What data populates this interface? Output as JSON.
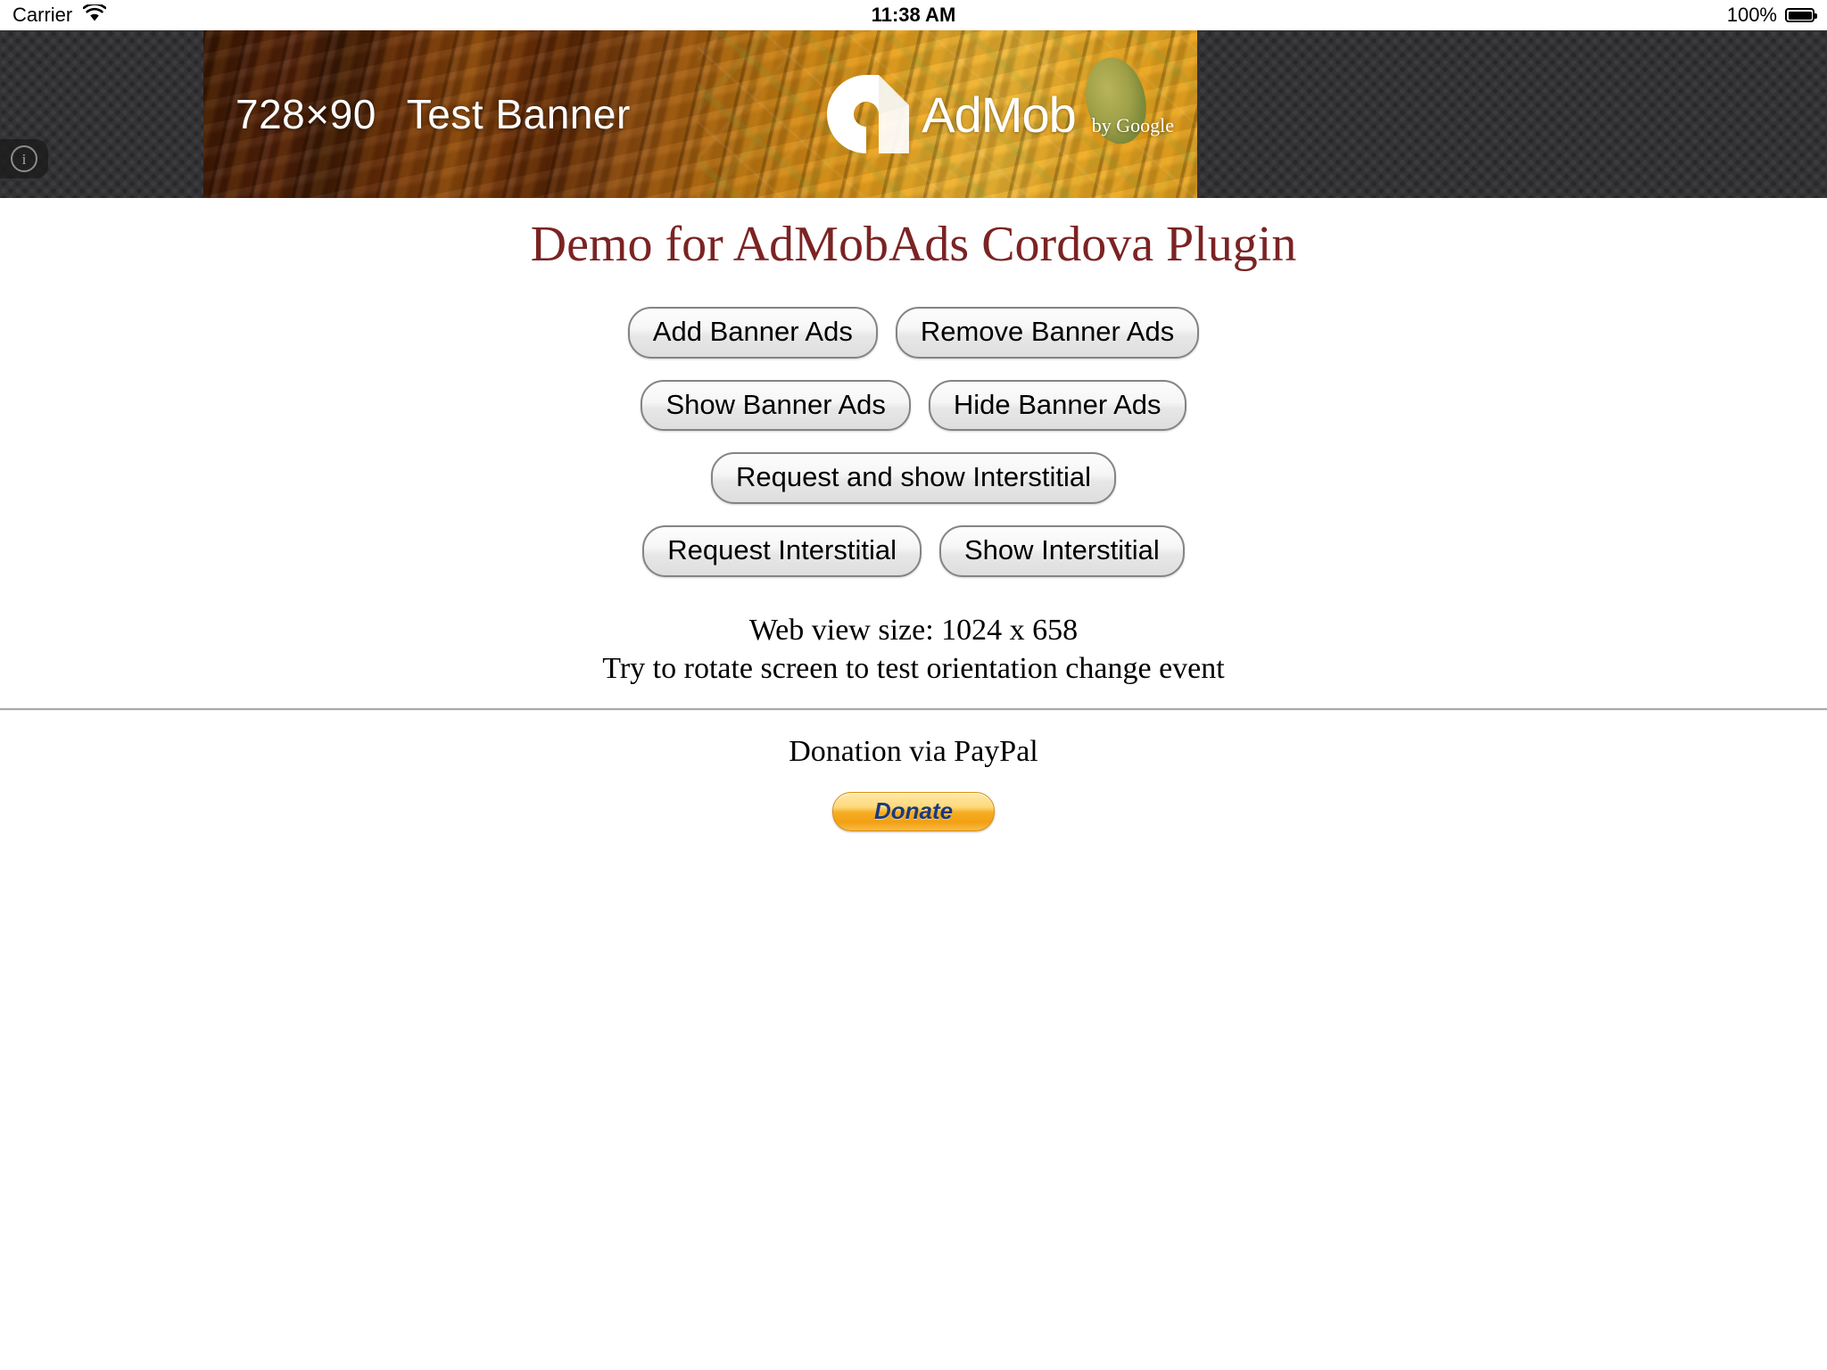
{
  "status_bar": {
    "carrier": "Carrier",
    "wifi_icon": "wifi-icon",
    "time": "11:38 AM",
    "battery_percent": "100%",
    "battery_icon": "battery-full-icon",
    "battery_level": 100
  },
  "ad_banner": {
    "size_text": "728×90",
    "title_text": "Test Banner",
    "brand_name": "AdMob",
    "brand_suffix": "by Google",
    "info_icon": "info-circle-icon",
    "info_glyph": "i",
    "logo_icon": "admob-logo-icon",
    "colors": {
      "strip_background": "#333336",
      "banner_orange": "#e8a01b",
      "banner_dark_brown": "#3a1703"
    }
  },
  "page": {
    "title": "Demo for AdMobAds Cordova Plugin",
    "title_color": "#7b2323",
    "button_rows": [
      [
        "Add Banner Ads",
        "Remove Banner Ads"
      ],
      [
        "Show Banner Ads",
        "Hide Banner Ads"
      ],
      [
        "Request and show Interstitial"
      ],
      [
        "Request Interstitial",
        "Show Interstitial"
      ]
    ],
    "buttons": {
      "add_banner_ads": "Add Banner Ads",
      "remove_banner_ads": "Remove Banner Ads",
      "show_banner_ads": "Show Banner Ads",
      "hide_banner_ads": "Hide Banner Ads",
      "request_and_show_interstitial": "Request and show Interstitial",
      "request_interstitial": "Request Interstitial",
      "show_interstitial": "Show Interstitial"
    },
    "webview_size_line": "Web view size: 1024 x 658",
    "rotate_hint_line": "Try to rotate screen to test orientation change event",
    "webview_width": 1024,
    "webview_height": 658
  },
  "donation": {
    "heading": "Donation via PayPal",
    "button_label": "Donate",
    "button_colors": {
      "background_orange": "#f6ad24",
      "text_blue": "#1b3a7a"
    }
  }
}
